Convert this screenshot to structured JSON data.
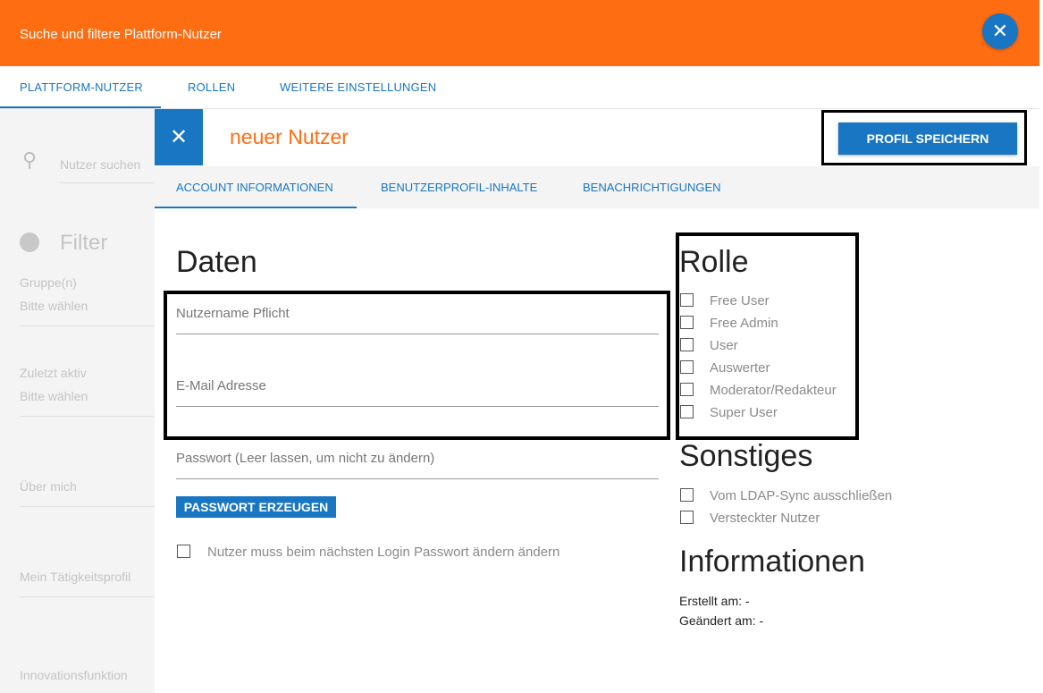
{
  "header": {
    "title": "Suche und filtere Plattform-Nutzer",
    "close_icon": "close-icon"
  },
  "main_tabs": [
    {
      "label": "PLATTFORM-NUTZER",
      "active": true
    },
    {
      "label": "ROLLEN",
      "active": false
    },
    {
      "label": "WEITERE EINSTELLUNGEN",
      "active": false
    }
  ],
  "sidebar": {
    "search_placeholder": "Nutzer suchen",
    "filter_title": "Filter",
    "fields": [
      {
        "label": "Gruppe(n)",
        "value": "Bitte wählen"
      },
      {
        "label": "Zuletzt aktiv",
        "value": "Bitte wählen"
      },
      {
        "label": "Über mich",
        "value": ""
      },
      {
        "label": "Mein Tätigkeitsprofil",
        "value": ""
      },
      {
        "label": "Innovationsfunktion",
        "value": ""
      }
    ]
  },
  "modal": {
    "heading": "neuer Nutzer",
    "save_label": "PROFIL SPEICHERN",
    "tabs": [
      {
        "label": "ACCOUNT INFORMATIONEN",
        "active": true
      },
      {
        "label": "BENUTZERPROFIL-INHALTE",
        "active": false
      },
      {
        "label": "BENACHRICHTIGUNGEN",
        "active": false
      }
    ],
    "daten": {
      "title": "Daten",
      "username_placeholder": "Nutzername Pflicht",
      "email_placeholder": "E-Mail Adresse",
      "password_placeholder": "Passwort (Leer lassen, um nicht zu ändern)",
      "generate_label": "PASSWORT ERZEUGEN",
      "must_change_label": "Nutzer muss beim nächsten Login Passwort ändern ändern"
    },
    "rolle": {
      "title": "Rolle",
      "options": [
        "Free User",
        "Free Admin",
        "User",
        "Auswerter",
        "Moderator/Redakteur",
        "Super User"
      ]
    },
    "sonstiges": {
      "title": "Sonstiges",
      "options": [
        "Vom LDAP-Sync ausschließen",
        "Versteckter Nutzer"
      ]
    },
    "informationen": {
      "title": "Informationen",
      "created": "Erstellt am: -",
      "changed": "Geändert am: -"
    }
  },
  "colors": {
    "accent_orange": "#ff6d12",
    "primary_blue": "#1976c2"
  }
}
